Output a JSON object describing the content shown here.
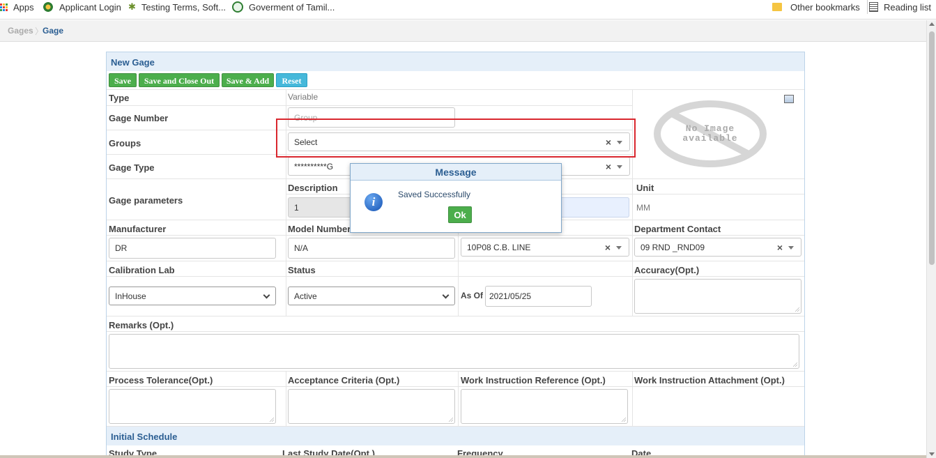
{
  "bookmarks": {
    "apps": "Apps",
    "items": [
      "Applicant Login",
      "Testing Terms, Soft...",
      "Goverment of Tamil..."
    ],
    "other": "Other bookmarks",
    "reading": "Reading list"
  },
  "breadcrumb": [
    "Gages",
    "Gage"
  ],
  "panel": {
    "title": "New Gage",
    "buttons": {
      "save": "Save",
      "save_close": "Save and Close Out",
      "save_add": "Save & Add",
      "reset": "Reset"
    }
  },
  "form": {
    "type_label": "Type",
    "type_value": "Variable",
    "gage_number_label": "Gage Number",
    "gage_number_placeholder": "Group",
    "groups_label": "Groups",
    "groups_value": "Select",
    "gage_type_label": "Gage Type",
    "gage_type_value": "**********G",
    "gage_params_label": "Gage parameters",
    "description_label": "Description",
    "description_value": "1",
    "unit_label": "Unit",
    "unit_value": "MM",
    "manufacturer_label": "Manufacturer",
    "manufacturer_value": "DR",
    "model_label": "Model Number",
    "model_value": "N/A",
    "location_value": "10P08 C.B. LINE",
    "dept_label": "Department Contact",
    "dept_value": "09 RND _RND09",
    "cal_lab_label": "Calibration Lab",
    "cal_lab_value": "InHouse",
    "status_label": "Status",
    "status_value": "Active",
    "as_of_label": "As Of",
    "as_of_value": "2021/05/25",
    "accuracy_label": "Accuracy(Opt.)",
    "remarks_label": "Remarks (Opt.)",
    "process_tol_label": "Process Tolerance(Opt.)",
    "acceptance_label": "Acceptance Criteria (Opt.)",
    "wi_ref_label": "Work Instruction Reference (Opt.)",
    "wi_attach_label": "Work Instruction Attachment (Opt.)"
  },
  "no_image": {
    "line1": "No Image",
    "line2": "available"
  },
  "schedule": {
    "title": "Initial Schedule",
    "columns": [
      "Study Type",
      "Last Study Date(Opt.)",
      "Frequency",
      "Date"
    ]
  },
  "message": {
    "title": "Message",
    "text": "Saved Successfully",
    "ok": "Ok"
  }
}
